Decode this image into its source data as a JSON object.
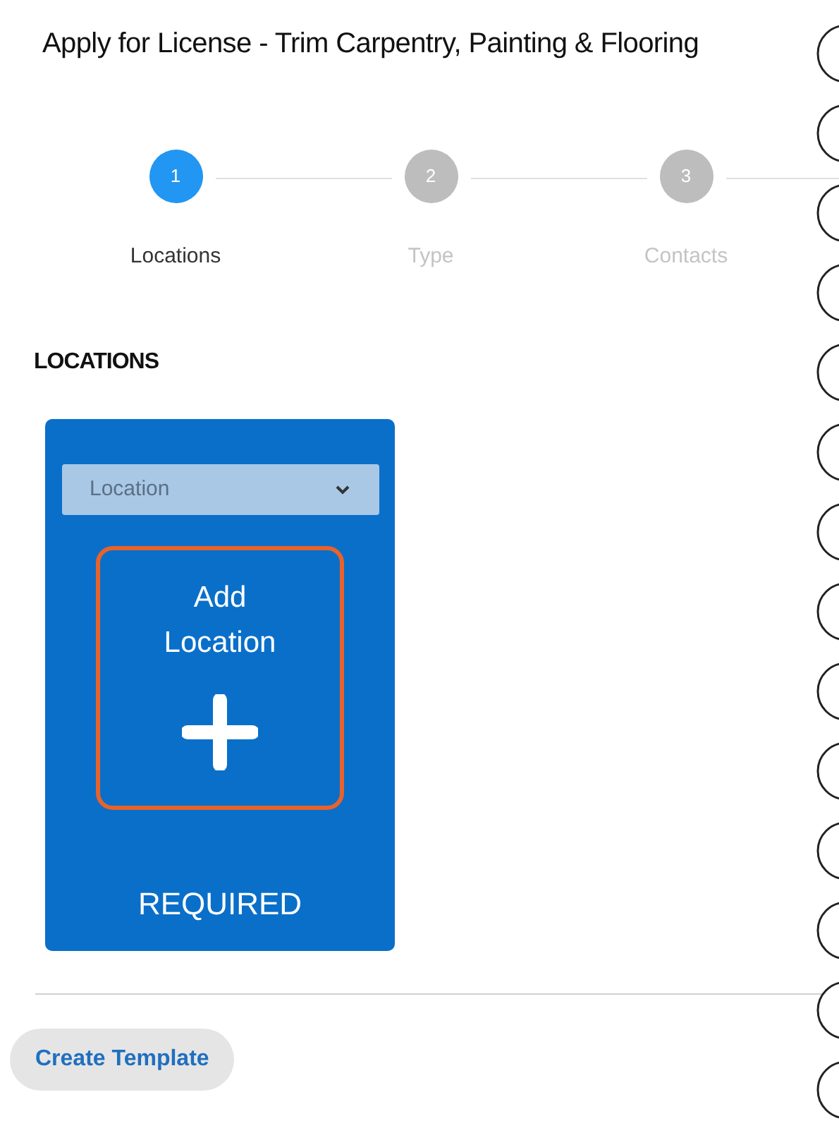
{
  "title": "Apply for License - Trim Carpentry, Painting & Flooring",
  "steps": [
    {
      "number": "1",
      "label": "Locations",
      "selected": true
    },
    {
      "number": "2",
      "label": "Type",
      "selected": false
    },
    {
      "number": "3",
      "label": "Contacts",
      "selected": false
    }
  ],
  "section_heading": "LOCATIONS",
  "location_card": {
    "select": {
      "placeholder": "Location"
    },
    "add_label": "Add Location",
    "status": "REQUIRED"
  },
  "buttons": [
    "Create Template"
  ]
}
